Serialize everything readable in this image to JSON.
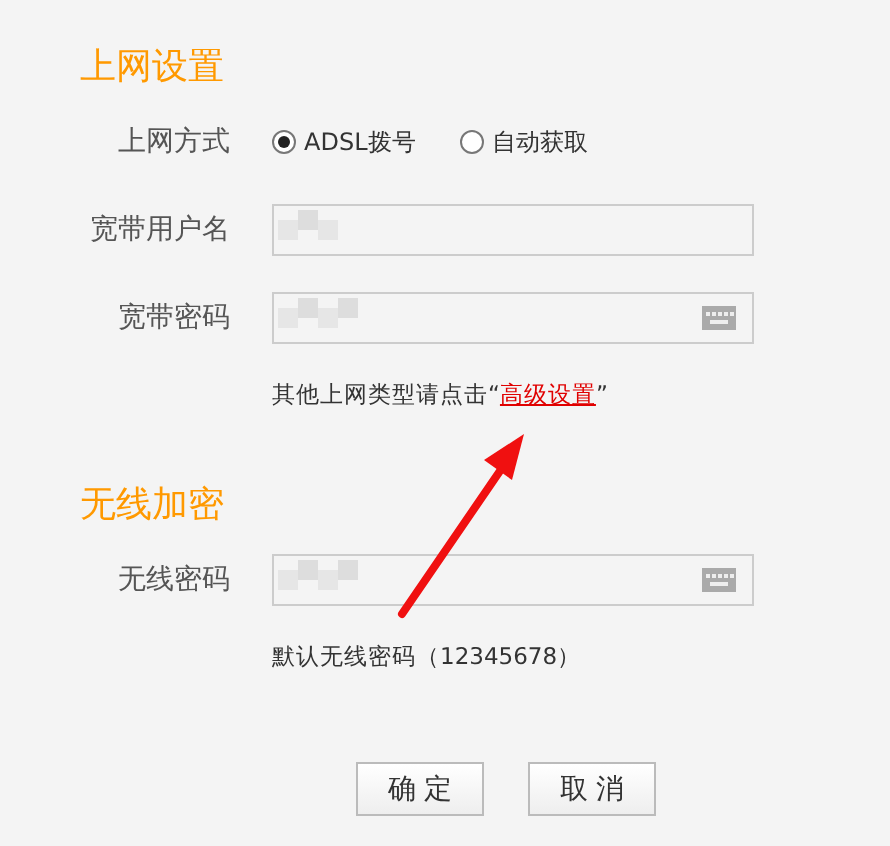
{
  "sections": [
    {
      "title": "上网设置",
      "rows": [
        {
          "kind": "radio",
          "label": "上网方式",
          "options": [
            {
              "label": "ADSL拨号",
              "selected": true
            },
            {
              "label": "自动获取",
              "selected": false
            }
          ]
        },
        {
          "kind": "text",
          "label": "宽带用户名",
          "masked": false
        },
        {
          "kind": "password",
          "label": "宽带密码",
          "masked": true
        },
        {
          "kind": "hint",
          "before": "其他上网类型请点击“",
          "link": "高级设置",
          "after": "”"
        }
      ]
    },
    {
      "title": "无线加密",
      "rows": [
        {
          "kind": "password",
          "label": "无线密码",
          "masked": true
        },
        {
          "kind": "hint",
          "before": "默认无线密码（12345678）"
        }
      ]
    }
  ],
  "buttons": [
    "确 定",
    "取 消"
  ]
}
